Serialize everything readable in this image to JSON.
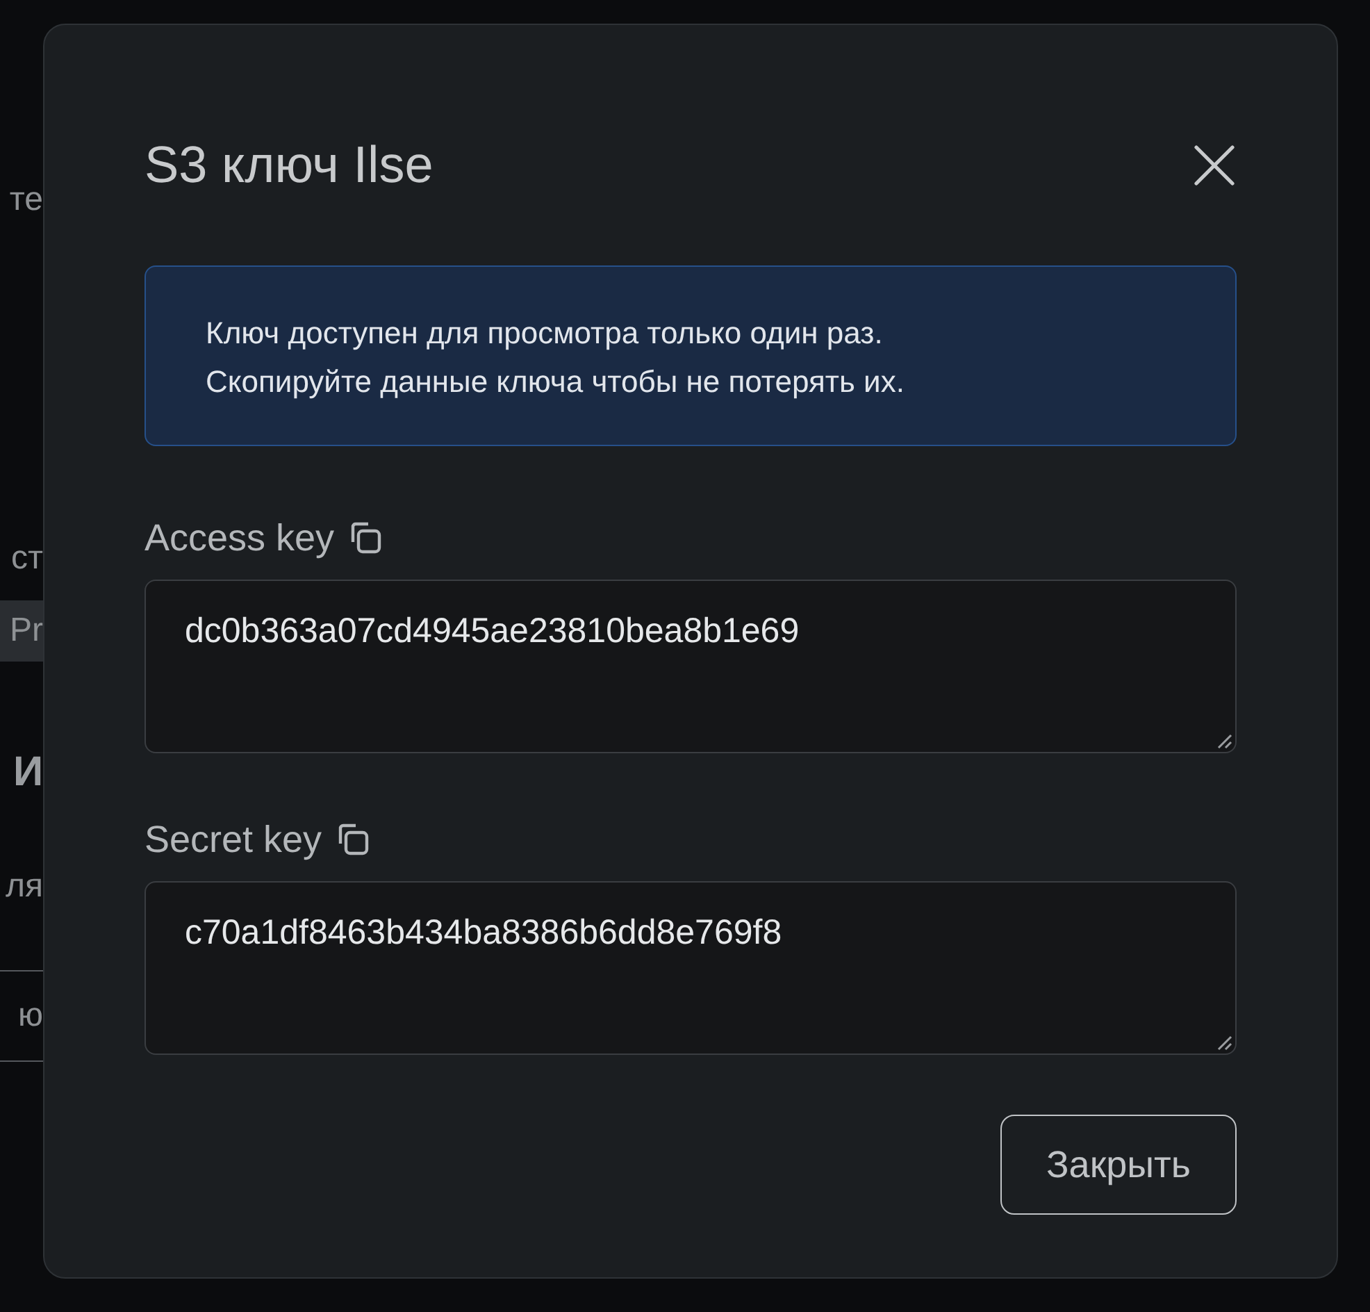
{
  "background": {
    "fragments": [
      {
        "kind": "text",
        "text": "те"
      },
      {
        "kind": "text",
        "text": "ст"
      },
      {
        "kind": "chip",
        "text": "Pr"
      },
      {
        "kind": "heading",
        "text": "И"
      },
      {
        "kind": "text",
        "text": "ля"
      },
      {
        "kind": "row",
        "text": "ю"
      }
    ]
  },
  "dialog": {
    "title": "S3 ключ Ilse",
    "notice": [
      "Ключ доступен для просмотра только один раз.",
      "Скопируйте данные ключа чтобы не потерять их."
    ],
    "fields": [
      {
        "label": "Access key",
        "value": "dc0b363a07cd4945ae23810bea8b1e69"
      },
      {
        "label": "Secret key",
        "value": "c70a1df8463b434ba8386b6dd8e769f8"
      }
    ],
    "buttons": [
      "Закрыть"
    ]
  }
}
